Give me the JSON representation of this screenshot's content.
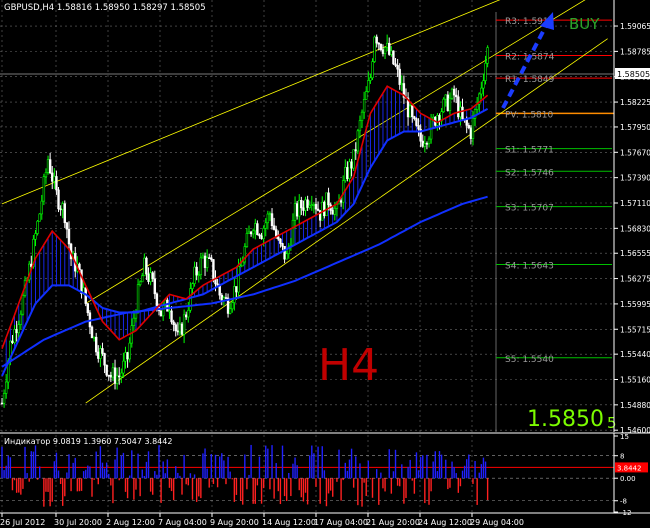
{
  "window": {
    "header": "GBPUSD,H4  1.58816 1.58950 1.58297 1.58505",
    "timeframe_big": "H4",
    "price_big": "1.5850",
    "price_big_suffix": "5",
    "signal": "BUY"
  },
  "colors": {
    "background": "#000000",
    "bull_candle": "#00ff00",
    "bear_candle": "#ffffff",
    "fast_ma": "#e00000",
    "slow_ma": "#1030ff",
    "long_ma": "#1030ff",
    "channel": "#ffff00",
    "pivot_line": "#ff8c00",
    "resistance": "#ff0000",
    "support": "#00c000",
    "timeframe_text": "#c00000",
    "price_text": "#7cfc00",
    "histogram_up": "#2020ff",
    "histogram_down": "#ff2020"
  },
  "chart_data": [
    {
      "type": "candlestick",
      "symbol": "GBPUSD",
      "period": "H4",
      "ylim": [
        1.5458,
        1.5922
      ],
      "x_ticks": [
        "26 Jul 2012",
        "30 Jul 20:00",
        "2 Aug 12:00",
        "7 Aug 04:00",
        "9 Aug 20:00",
        "14 Aug 12:00",
        "17 Aug 04:00",
        "21 Aug 20:00",
        "24 Aug 12:00",
        "29 Aug 04:00"
      ],
      "y_ticks": [
        "1.59065",
        "1.58785",
        "1.58505",
        "1.58225",
        "1.57950",
        "1.57670",
        "1.57390",
        "1.57110",
        "1.56830",
        "1.56555",
        "1.56275",
        "1.55995",
        "1.55715",
        "1.55440",
        "1.55160",
        "1.54880",
        "1.54600"
      ],
      "current_price": "1.58505",
      "pivot_levels": [
        {
          "name": "R3",
          "value": 1.5913,
          "text": "R3: 1.5913"
        },
        {
          "name": "R2",
          "value": 1.5874,
          "text": "R2: 1.5874"
        },
        {
          "name": "R1",
          "value": 1.5849,
          "text": "R1: 1.5849"
        },
        {
          "name": "PV",
          "value": 1.581,
          "text": "PV: 1.5810"
        },
        {
          "name": "S1",
          "value": 1.5771,
          "text": "S1: 1.5771"
        },
        {
          "name": "S2",
          "value": 1.5746,
          "text": "S2: 1.5746"
        },
        {
          "name": "S3",
          "value": 1.5707,
          "text": "S3: 1.5707"
        },
        {
          "name": "S4",
          "value": 1.5643,
          "text": "S4: 1.5643"
        },
        {
          "name": "S5",
          "value": 1.554,
          "text": "S5: 1.5540"
        }
      ],
      "close_path": [
        [
          0,
          1.549
        ],
        [
          4,
          1.5555
        ],
        [
          8,
          1.5585
        ],
        [
          12,
          1.5625
        ],
        [
          14,
          1.565
        ],
        [
          18,
          1.57
        ],
        [
          22,
          1.576
        ],
        [
          26,
          1.572
        ],
        [
          30,
          1.57
        ],
        [
          33,
          1.565
        ],
        [
          36,
          1.564
        ],
        [
          40,
          1.56
        ],
        [
          44,
          1.556
        ],
        [
          48,
          1.554
        ],
        [
          52,
          1.552
        ],
        [
          56,
          1.552
        ],
        [
          60,
          1.554
        ],
        [
          64,
          1.56
        ],
        [
          68,
          1.564
        ],
        [
          72,
          1.562
        ],
        [
          76,
          1.559
        ],
        [
          80,
          1.56
        ],
        [
          84,
          1.556
        ],
        [
          88,
          1.559
        ],
        [
          92,
          1.563
        ],
        [
          96,
          1.565
        ],
        [
          100,
          1.564
        ],
        [
          104,
          1.561
        ],
        [
          108,
          1.56
        ],
        [
          112,
          1.562
        ],
        [
          116,
          1.566
        ],
        [
          120,
          1.569
        ],
        [
          124,
          1.568
        ],
        [
          128,
          1.57
        ],
        [
          132,
          1.5665
        ],
        [
          136,
          1.565
        ],
        [
          140,
          1.57
        ],
        [
          144,
          1.571
        ],
        [
          148,
          1.572
        ],
        [
          152,
          1.57
        ],
        [
          156,
          1.5715
        ],
        [
          160,
          1.57
        ],
        [
          164,
          1.574
        ],
        [
          168,
          1.576
        ],
        [
          172,
          1.581
        ],
        [
          176,
          1.585
        ],
        [
          178,
          1.59
        ],
        [
          180,
          1.589
        ],
        [
          184,
          1.588
        ],
        [
          188,
          1.586
        ],
        [
          192,
          1.583
        ],
        [
          196,
          1.58
        ],
        [
          200,
          1.578
        ],
        [
          204,
          1.579
        ],
        [
          208,
          1.581
        ],
        [
          212,
          1.582
        ],
        [
          216,
          1.583
        ],
        [
          220,
          1.58
        ],
        [
          224,
          1.579
        ],
        [
          228,
          1.583
        ],
        [
          232,
          1.588
        ]
      ],
      "fast_ma": [
        [
          0,
          1.555
        ],
        [
          8,
          1.56
        ],
        [
          16,
          1.565
        ],
        [
          24,
          1.568
        ],
        [
          32,
          1.566
        ],
        [
          40,
          1.562
        ],
        [
          48,
          1.558
        ],
        [
          56,
          1.556
        ],
        [
          64,
          1.557
        ],
        [
          72,
          1.559
        ],
        [
          80,
          1.561
        ],
        [
          88,
          1.5605
        ],
        [
          96,
          1.562
        ],
        [
          104,
          1.563
        ],
        [
          112,
          1.564
        ],
        [
          120,
          1.566
        ],
        [
          128,
          1.567
        ],
        [
          136,
          1.568
        ],
        [
          144,
          1.569
        ],
        [
          152,
          1.57
        ],
        [
          160,
          1.571
        ],
        [
          168,
          1.574
        ],
        [
          176,
          1.581
        ],
        [
          184,
          1.584
        ],
        [
          192,
          1.583
        ],
        [
          200,
          1.581
        ],
        [
          208,
          1.58
        ],
        [
          216,
          1.581
        ],
        [
          224,
          1.5815
        ],
        [
          232,
          1.583
        ]
      ],
      "slow_ma": [
        [
          0,
          1.552
        ],
        [
          8,
          1.556
        ],
        [
          16,
          1.56
        ],
        [
          24,
          1.562
        ],
        [
          32,
          1.562
        ],
        [
          40,
          1.561
        ],
        [
          48,
          1.5595
        ],
        [
          56,
          1.559
        ],
        [
          64,
          1.559
        ],
        [
          72,
          1.5595
        ],
        [
          80,
          1.56
        ],
        [
          88,
          1.5605
        ],
        [
          96,
          1.561
        ],
        [
          104,
          1.562
        ],
        [
          112,
          1.563
        ],
        [
          120,
          1.564
        ],
        [
          128,
          1.565
        ],
        [
          136,
          1.566
        ],
        [
          144,
          1.567
        ],
        [
          152,
          1.568
        ],
        [
          160,
          1.569
        ],
        [
          168,
          1.571
        ],
        [
          176,
          1.575
        ],
        [
          184,
          1.578
        ],
        [
          192,
          1.579
        ],
        [
          200,
          1.579
        ],
        [
          208,
          1.5795
        ],
        [
          216,
          1.58
        ],
        [
          224,
          1.5805
        ],
        [
          232,
          1.5815
        ]
      ],
      "long_ma": [
        [
          0,
          1.553
        ],
        [
          20,
          1.556
        ],
        [
          40,
          1.558
        ],
        [
          60,
          1.559
        ],
        [
          80,
          1.5595
        ],
        [
          100,
          1.56
        ],
        [
          120,
          1.561
        ],
        [
          140,
          1.5625
        ],
        [
          160,
          1.5645
        ],
        [
          180,
          1.5665
        ],
        [
          200,
          1.569
        ],
        [
          220,
          1.571
        ],
        [
          232,
          1.5718
        ]
      ],
      "channel": {
        "upper": [
          [
            0,
            1.571
          ],
          [
            232,
            1.593
          ]
        ],
        "lower": [
          [
            40,
            1.549
          ],
          [
            232,
            1.58
          ]
        ],
        "mid": [
          [
            40,
            1.56
          ],
          [
            232,
            1.587
          ]
        ]
      }
    },
    {
      "type": "bar",
      "name": "Индикатор",
      "header": "Индикатор    9.0819  1.3960  7.5047  3.8442",
      "values_shown": [
        9.0819,
        1.396,
        7.5047,
        3.8442
      ],
      "ylim": [
        -12,
        15
      ],
      "y_ticks": [
        "15",
        "8",
        "3.8442",
        "0.00",
        "-8",
        "-12"
      ],
      "last_value": 3.8442
    }
  ]
}
